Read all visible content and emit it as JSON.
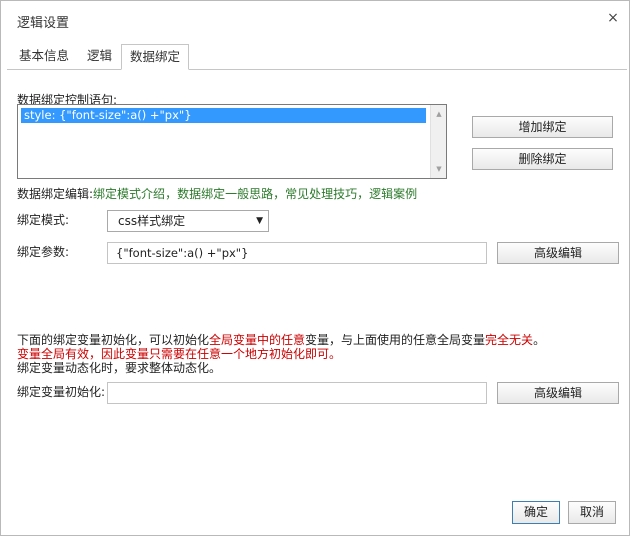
{
  "dialog": {
    "title": "逻辑设置",
    "close_glyph": "×"
  },
  "tabs": [
    {
      "label": "基本信息"
    },
    {
      "label": "逻辑"
    },
    {
      "label": "数据绑定"
    }
  ],
  "binding": {
    "control_label": "数据绑定控制语句:",
    "list_items": [
      "style: {\"font-size\":a() +\"px\"}"
    ],
    "add_button": "增加绑定",
    "delete_button": "删除绑定",
    "edit_prefix": "数据绑定编辑:",
    "links": [
      "绑定模式介绍",
      "数据绑定一般思路",
      "常见处理技巧",
      "逻辑案例"
    ],
    "link_separator": "，",
    "mode_label": "绑定模式:",
    "mode_value": "css样式绑定",
    "param_label": "绑定参数:",
    "param_value": "{\"font-size\":a() +\"px\"}",
    "advanced_button": "高级编辑"
  },
  "notes": {
    "line1_a": "下面的绑定变量初始化，可以初始化",
    "line1_b": "全局变量中的任意",
    "line1_c": "变量，与上面使用的任意全局变量",
    "line1_d": "完全无关",
    "line1_e": "。",
    "line2": "变量全局有效，因此变量只需要在任意一个地方初始化即可。",
    "line3": "绑定变量动态化时，要求整体动态化。"
  },
  "init": {
    "label": "绑定变量初始化:",
    "value": "",
    "advanced_button": "高级编辑"
  },
  "footer": {
    "ok_button": "确定",
    "cancel_button": "取消"
  }
}
